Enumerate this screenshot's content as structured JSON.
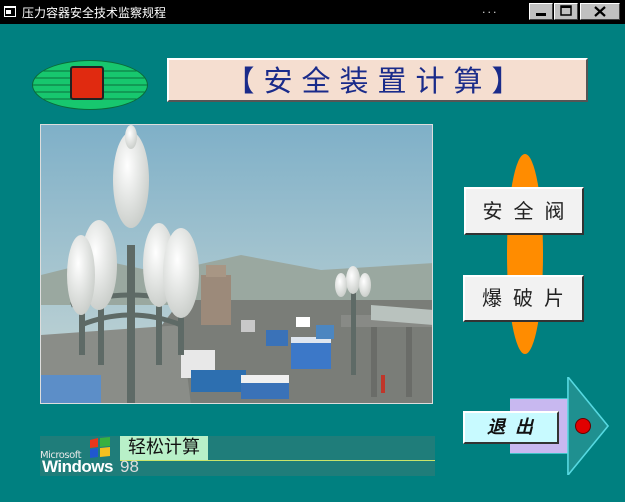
{
  "window": {
    "title": "压力容器安全技术监察规程",
    "dots": "...",
    "min_glyph": "▬",
    "max_glyph": "□",
    "close_glyph": "✕"
  },
  "banner": {
    "text": "【安全装置计算】"
  },
  "buttons": {
    "safety_valve": "安全阀",
    "bursting_disc": "爆破片",
    "exit": "退出"
  },
  "footer": {
    "microsoft": "Microsoft",
    "windows": "Windows",
    "version": "98",
    "easy_calc": "轻松计算"
  },
  "colors": {
    "background": "#008080",
    "banner_bg": "#f5ded0",
    "banner_text": "#1a2b8a",
    "accent_orange": "#ff8c00",
    "exit_bg": "#c8faff",
    "red_dot": "#e00000"
  },
  "icons": {
    "app": "app-window-icon",
    "logo": "green-ellipse-red-box-logo",
    "photo": "street-lamps-traffic-photo",
    "windows_flag": "windows-flag-icon"
  }
}
